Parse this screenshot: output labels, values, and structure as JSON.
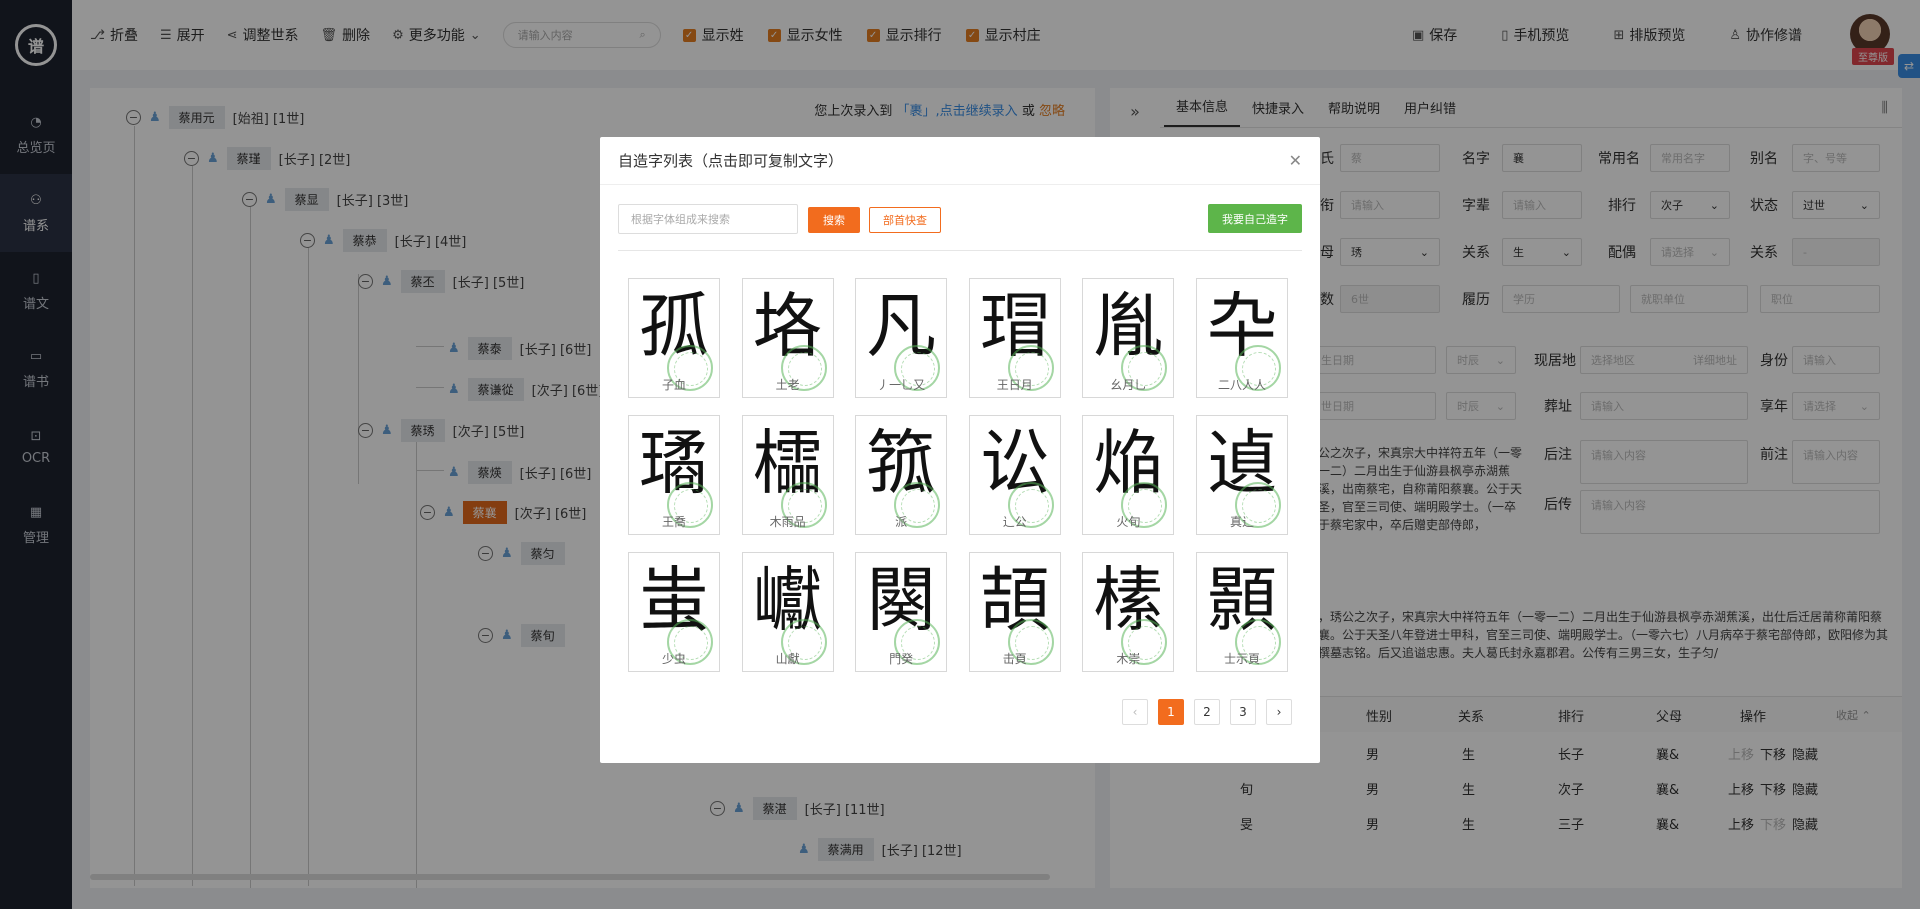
{
  "sidebar": {
    "logo": "谱",
    "items": [
      {
        "label": "总览页",
        "icon": "pie-chart-icon"
      },
      {
        "label": "谱系",
        "icon": "tree-icon"
      },
      {
        "label": "谱文",
        "icon": "document-icon"
      },
      {
        "label": "谱书",
        "icon": "book-icon"
      },
      {
        "label": "OCR",
        "icon": "scan-icon"
      },
      {
        "label": "管理",
        "icon": "grid-icon"
      }
    ]
  },
  "toolbar": {
    "collapse": "折叠",
    "expand": "展开",
    "adjust": "调整世系",
    "delete": "删除",
    "more": "更多功能",
    "search_placeholder": "请输入内容",
    "checks": [
      "显示姓",
      "显示女性",
      "显示排行",
      "显示村庄"
    ],
    "save": "保存",
    "mobile_preview": "手机预览",
    "layout_preview": "排版预览",
    "collab": "协作修谱",
    "vip": "至尊版"
  },
  "tree": {
    "tip_prefix": "您上次录入到",
    "tip_name": "「裹",
    "tip_link": "」,点击继续录入",
    "tip_or": "或",
    "tip_ignore": "忽略",
    "nodes": [
      {
        "name": "蔡用元",
        "rank": "[始祖] [1世]"
      },
      {
        "name": "蔡瑾",
        "rank": "[长子] [2世]"
      },
      {
        "name": "蔡显",
        "rank": "[长子] [3世]"
      },
      {
        "name": "蔡恭",
        "rank": "[长子] [4世]"
      },
      {
        "name": "蔡丕",
        "rank": "[长子] [5世]"
      },
      {
        "name": "蔡泰",
        "rank": "[长子] [6世]"
      },
      {
        "name": "蔡谦從",
        "rank": "[次子] [6世]"
      },
      {
        "name": "蔡琇",
        "rank": "[次子] [5世]"
      },
      {
        "name": "蔡煐",
        "rank": "[长子] [6世]"
      },
      {
        "name": "蔡襄",
        "rank": "[次子] [6世]"
      },
      {
        "name": "蔡匀",
        "rank": ""
      },
      {
        "name": "蔡旬",
        "rank": ""
      },
      {
        "name": "蔡湛",
        "rank": "[长子] [11世]"
      },
      {
        "name": "蔡满用",
        "rank": "[长子] [12世]"
      }
    ]
  },
  "right_panel": {
    "tabs": [
      "基本信息",
      "快捷录入",
      "帮助说明",
      "用户纠错"
    ],
    "fields": {
      "surname_label": "氏",
      "surname_value": "蔡",
      "given_label": "名字",
      "given_value": "襄",
      "common_label": "常用名",
      "common_ph": "常用名字",
      "alias_label": "别名",
      "alias_ph": "字、号等",
      "gen_label": "衔",
      "gen_ph": "请输入",
      "bei_label": "字辈",
      "bei_ph": "请输入",
      "order_label": "排行",
      "order_value": "次子",
      "status_label": "状态",
      "status_value": "过世",
      "mother_label": "母",
      "mother_value": "琇",
      "relation_label": "关系",
      "relation_value": "生",
      "spouse_label": "配偶",
      "spouse_ph": "请选择",
      "relation2_label": "关系",
      "shu_label": "数",
      "shu_value": "6世",
      "resume_label": "履历",
      "edu_ph": "学历",
      "work_ph": "就职单位",
      "post_ph": "职位",
      "birth_ph": "生日期",
      "era_ph": "时辰",
      "residence_label": "现居地",
      "region_ph": "选择地区",
      "addr_ph": "详细地址",
      "identity_label": "身份",
      "identity_ph": "请输入",
      "death_ph": "世日期",
      "burial_label": "葬址",
      "burial_ph": "请输入",
      "age_label": "享年",
      "age_ph": "请选择",
      "houzhu_label": "后注",
      "houzhu_ph": "请输入内容",
      "qianzhu_label": "前注",
      "qianzhu_ph": "请输入内容",
      "houzhuan_label": "后传",
      "houzhuan_ph": "请输入内容"
    },
    "bio_short": "公之次子，宋真宗大中祥符五年（一零一二）二月出生于仙游县枫亭赤湖蕉溪，出南蔡宅，自称莆阳蔡襄。公于天圣，官至三司使、端明殿学士。（一卒于蔡宅家中，卒后赠吏部侍郎，",
    "bio_long": "，琇公之次子，宋真宗大中祥符五年（一零一二）二月出生于仙游县枫亭赤湖蕉溪，出仕后迁居莆称莆阳蔡襄。公于天圣八年登进士甲科，官至三司使、端明殿学士。（一零六七）八月病卒于蔡宅部侍郎，欧阳修为其撰墓志铭。后又追谥忠惠。夫人葛氏封永嘉郡君。公传有三男三女，生子匀/",
    "table": {
      "headers": [
        "性别",
        "关系",
        "排行",
        "父母",
        "操作"
      ],
      "collapse": "收起",
      "rows": [
        {
          "name": "",
          "sex": "男",
          "rel": "生",
          "order": "长子",
          "parent": "襄&",
          "ops": [
            "上移",
            "下移",
            "隐藏"
          ]
        },
        {
          "name": "旬",
          "sex": "男",
          "rel": "生",
          "order": "次子",
          "parent": "襄&",
          "ops": [
            "上移",
            "下移",
            "隐藏"
          ]
        },
        {
          "name": "旻",
          "sex": "男",
          "rel": "生",
          "order": "三子",
          "parent": "襄&",
          "ops": [
            "上移",
            "下移",
            "隐藏"
          ]
        }
      ]
    }
  },
  "modal": {
    "title": "自造字列表（点击即可复制文字）",
    "search_ph": "根据字体组成来搜索",
    "search_btn": "搜索",
    "radical_btn": "部首快查",
    "make_btn": "我要自己造字",
    "chars": [
      {
        "glyph": "孤",
        "parts": "子血"
      },
      {
        "glyph": "垎",
        "parts": "土老"
      },
      {
        "glyph": "凡",
        "parts": "丿一乚又"
      },
      {
        "glyph": "瑁",
        "parts": "王日月"
      },
      {
        "glyph": "胤",
        "parts": "幺月乚"
      },
      {
        "glyph": "卆",
        "parts": "二八人人"
      },
      {
        "glyph": "璚",
        "parts": "王喬"
      },
      {
        "glyph": "櫺",
        "parts": "木雨品"
      },
      {
        "glyph": "箛",
        "parts": "派"
      },
      {
        "glyph": "讼",
        "parts": "辶公"
      },
      {
        "glyph": "焔",
        "parts": "火旬"
      },
      {
        "glyph": "遉",
        "parts": "真辶"
      },
      {
        "glyph": "蚩",
        "parts": "少虫"
      },
      {
        "glyph": "巘",
        "parts": "山獻"
      },
      {
        "glyph": "闋",
        "parts": "門癸"
      },
      {
        "glyph": "頡",
        "parts": "击頁"
      },
      {
        "glyph": "榡",
        "parts": "木崇"
      },
      {
        "glyph": "顥",
        "parts": "士示頁"
      }
    ],
    "pages": [
      "1",
      "2",
      "3"
    ],
    "prev": "‹",
    "next": "›"
  }
}
